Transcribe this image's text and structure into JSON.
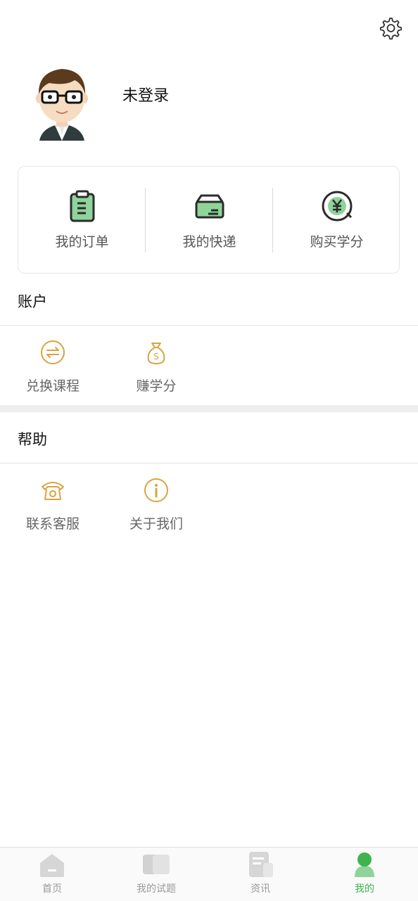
{
  "profile": {
    "username": "未登录"
  },
  "quick_actions": [
    {
      "label": "我的订单",
      "icon": "clipboard-icon"
    },
    {
      "label": "我的快递",
      "icon": "delivery-box-icon"
    },
    {
      "label": "购买学分",
      "icon": "yen-coin-icon"
    }
  ],
  "account_section": {
    "title": "账户",
    "items": [
      {
        "label": "兑换课程",
        "icon": "exchange-icon"
      },
      {
        "label": "赚学分",
        "icon": "money-bag-icon"
      }
    ]
  },
  "help_section": {
    "title": "帮助",
    "items": [
      {
        "label": "联系客服",
        "icon": "telephone-icon"
      },
      {
        "label": "关于我们",
        "icon": "info-icon"
      }
    ]
  },
  "tabbar": [
    {
      "label": "首页",
      "icon": "home-icon"
    },
    {
      "label": "我的试题",
      "icon": "question-book-icon"
    },
    {
      "label": "资讯",
      "icon": "news-icon"
    },
    {
      "label": "我的",
      "icon": "profile-icon",
      "active": true
    }
  ],
  "colors": {
    "accent_green": "#3fb34f",
    "gold": "#d8a441",
    "icon_dark": "#2b2b2b",
    "icon_green": "#8fd49a"
  }
}
